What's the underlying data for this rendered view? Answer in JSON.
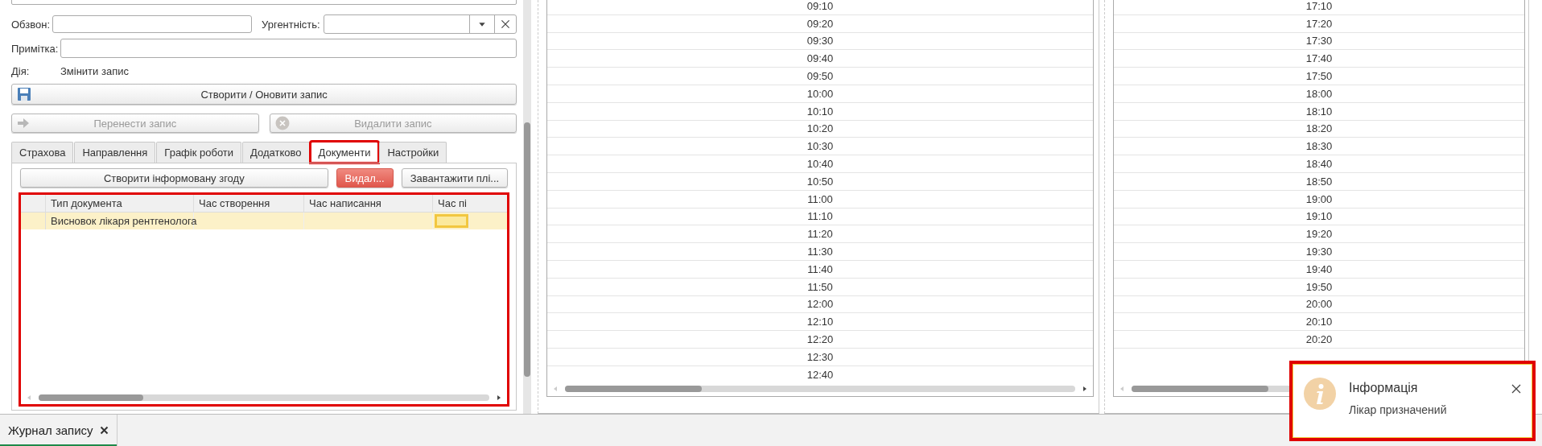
{
  "form": {
    "call_label": "Обзвон:",
    "urgency_label": "Ургентність:",
    "note_label": "Примітка:",
    "action_label": "Дія:",
    "action_value": "Змінити запис",
    "save_button": {
      "label": "Створити / Оновити запис",
      "disabled": false
    },
    "move_button": {
      "label": "Перенести запис",
      "disabled": true
    },
    "delete_button": {
      "label": "Видалити запис",
      "disabled": true
    }
  },
  "tabs": [
    {
      "label": "Страхова",
      "selected": false,
      "highlighted": false
    },
    {
      "label": "Направлення",
      "selected": false,
      "highlighted": false
    },
    {
      "label": "Графік роботи",
      "selected": false,
      "highlighted": false
    },
    {
      "label": "Додатково",
      "selected": false,
      "highlighted": false
    },
    {
      "label": "Документи",
      "selected": true,
      "highlighted": true
    },
    {
      "label": "Настройки",
      "selected": false,
      "highlighted": false
    }
  ],
  "documents": {
    "buttons": [
      {
        "label": "Створити інформовану згоду",
        "kind": "normal"
      },
      {
        "label": "Видал...",
        "kind": "danger"
      },
      {
        "label": "Завантажити плі...",
        "kind": "normal"
      }
    ],
    "table": {
      "highlighted": true,
      "columns": [
        "Тип документа",
        "Час створення",
        "Час написання",
        "Час пі"
      ],
      "rows": [
        {
          "selected": true,
          "cells": [
            {
              "text": "Висновок лікаря рентгенолога",
              "focused": false
            },
            {
              "focused": false
            },
            {
              "focused": false
            },
            {
              "focused": true
            }
          ]
        }
      ]
    }
  },
  "schedule": [
    {
      "slots": [
        "09:10",
        "09:20",
        "09:30",
        "09:40",
        "09:50",
        "10:00",
        "10:10",
        "10:20",
        "10:30",
        "10:40",
        "10:50",
        "11:00",
        "11:10",
        "11:20",
        "11:30",
        "11:40",
        "11:50",
        "12:00",
        "12:10",
        "12:20",
        "12:30",
        "12:40"
      ]
    },
    {
      "slots": [
        "17:10",
        "17:20",
        "17:30",
        "17:40",
        "17:50",
        "18:00",
        "18:10",
        "18:20",
        "18:30",
        "18:40",
        "18:50",
        "19:00",
        "19:10",
        "19:20",
        "19:30",
        "19:40",
        "19:50",
        "20:00",
        "20:10",
        "20:20"
      ]
    }
  ],
  "bottom_tabs": [
    {
      "label": "Журнал запису",
      "selected": true
    }
  ],
  "notification": {
    "title": "Інформація",
    "message": "Лікар призначений",
    "highlighted": true
  }
}
